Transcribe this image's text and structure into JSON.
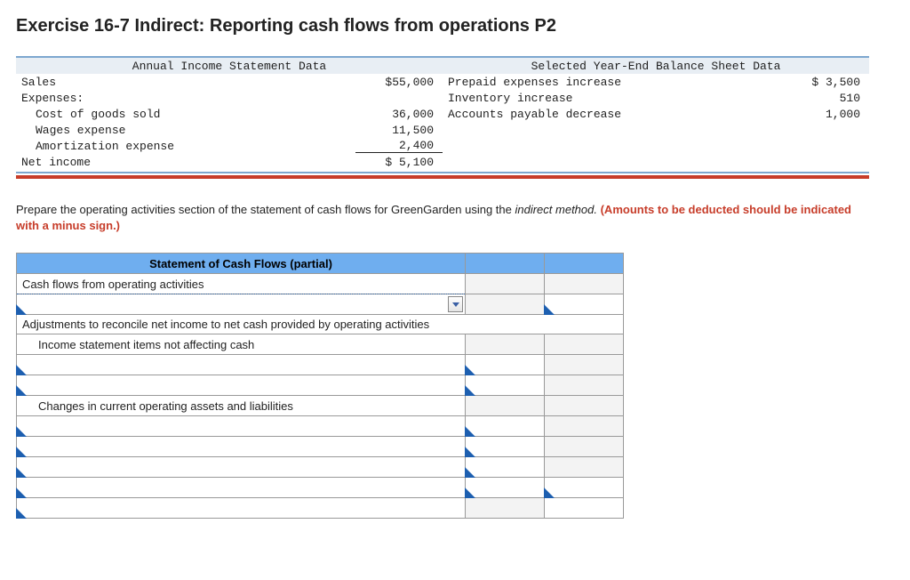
{
  "title": "Exercise 16-7 Indirect: Reporting cash flows from operations P2",
  "left_header": "Annual Income Statement Data",
  "right_header": "Selected Year-End Balance Sheet Data",
  "income": {
    "sales_label": "Sales",
    "sales_value": "$55,000",
    "expenses_label": "Expenses:",
    "cogs_label": "Cost of goods sold",
    "cogs_value": "36,000",
    "wages_label": "Wages expense",
    "wages_value": "11,500",
    "amort_label": "Amortization expense",
    "amort_value": "2,400",
    "net_income_label": "Net income",
    "net_income_value": "$ 5,100"
  },
  "balance": {
    "prepaid_label": "Prepaid expenses increase",
    "prepaid_value": "$ 3,500",
    "inventory_label": "Inventory increase",
    "inventory_value": "510",
    "ap_label": "Accounts payable decrease",
    "ap_value": "1,000"
  },
  "instructions_pre": "Prepare the operating activities section of the statement of cash flows for GreenGarden using the ",
  "instructions_italic": "indirect method.",
  "instructions_red": " (Amounts to be deducted should be indicated with a minus sign.)",
  "worksheet": {
    "title": "Statement of Cash Flows (partial)",
    "row_cash_flows": "Cash flows from operating activities",
    "row_adjustments": "Adjustments to reconcile net income to net cash provided by operating activities",
    "row_income_items": "Income statement items not affecting cash",
    "row_changes": "Changes in current operating assets and liabilities"
  }
}
